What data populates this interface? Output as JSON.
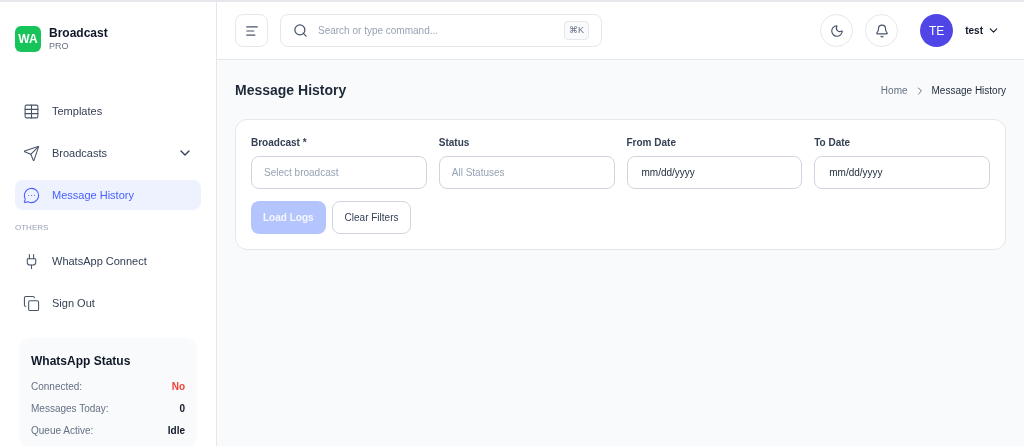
{
  "brand": {
    "logo": "WA",
    "name": "Broadcast",
    "tier": "PRO"
  },
  "sidebar": {
    "items": [
      {
        "label": "Templates",
        "selected": false
      },
      {
        "label": "Broadcasts",
        "selected": false,
        "expanded": false
      },
      {
        "label": "Message History",
        "selected": true
      }
    ],
    "section_title": "OTHERS",
    "other_items": [
      {
        "label": "WhatsApp Connect",
        "selected": false
      },
      {
        "label": "Sign Out",
        "selected": false
      }
    ],
    "status_card": {
      "title": "WhatsApp Status",
      "rows": [
        {
          "label": "Connected:",
          "value": "No",
          "kind": "alert"
        },
        {
          "label": "Messages Today:",
          "value": "0",
          "kind": "plain"
        },
        {
          "label": "Queue Active:",
          "value": "Idle",
          "kind": "plain"
        }
      ]
    }
  },
  "header": {
    "search_placeholder": "Search or type command...",
    "shortcut": "⌘K",
    "avatar": "TE",
    "user": "test"
  },
  "page": {
    "title": "Message History",
    "breadcrumb": [
      {
        "label": "Home",
        "current": false
      },
      {
        "label": "Message History",
        "current": true
      }
    ]
  },
  "filters": {
    "fields": [
      {
        "label": "Broadcast *",
        "kind": "select",
        "placeholder": "Select broadcast"
      },
      {
        "label": "Status",
        "kind": "select",
        "placeholder": "All Statuses"
      },
      {
        "label": "From Date",
        "kind": "date",
        "value": "mm/dd/yyyy"
      },
      {
        "label": "To Date",
        "kind": "date",
        "value": "mm/dd/yyyy"
      }
    ],
    "buttons": [
      {
        "label": "Load Logs",
        "kind": "primary",
        "disabled": true
      },
      {
        "label": "Clear Filters",
        "kind": "secondary",
        "disabled": false
      }
    ]
  }
}
